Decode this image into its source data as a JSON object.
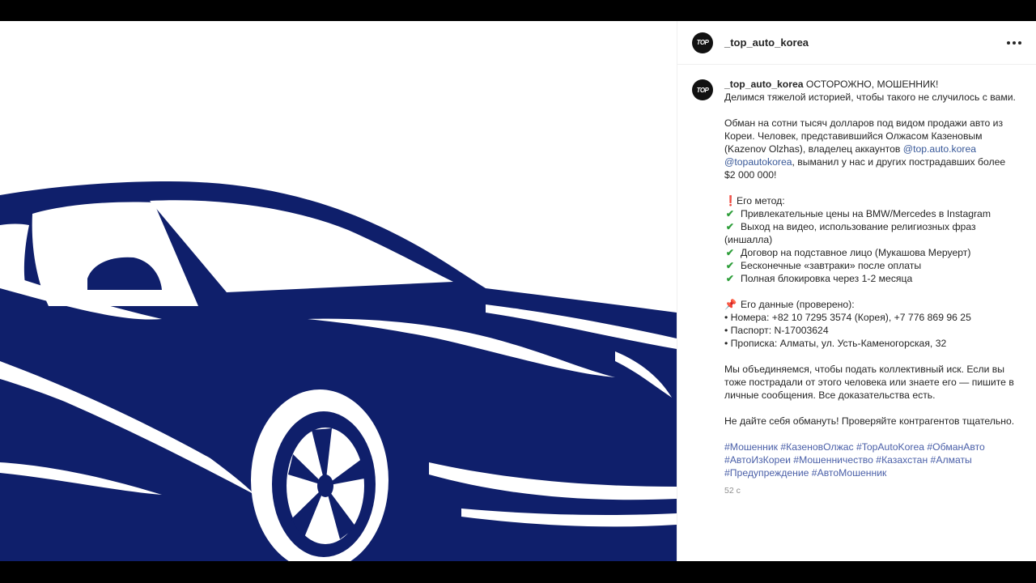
{
  "header": {
    "username": "_top_auto_korea",
    "avatar_text": "TOP",
    "more_icon": "more-horizontal-icon"
  },
  "caption": {
    "username": "_top_auto_korea",
    "title": "ОСТОРОЖНО, МОШЕННИК!",
    "intro": "Делимся тяжелой историей, чтобы такого не случилось с вами.",
    "p2_a": "Обман на сотни тысяч долларов под видом продажи авто из Кореи. Человек, представившийся Олжасом Казеновым (Kazenov Olzhas), владелец аккаунтов ",
    "p2_link1": "@top.auto.korea",
    "p2_link2": "@topautokorea",
    "p2_b": ", выманил у нас и других пострадавших более $2 000 000!",
    "method_title": "Его метод:",
    "method_items": [
      "Привлекательные цены на BMW/Mercedes в Instagram",
      "Выход на видео, использование религиозных фраз (иншалла)",
      "Договор на подставное лицо (Мукашова Меруерт)",
      "Бесконечные «завтраки» после оплаты",
      "Полная блокировка через 1-2 месяца"
    ],
    "data_title": "Его данные (проверено):",
    "data_items": [
      "• Номера: +82 10 7295 3574 (Корея), +7 776 869 96 25",
      "• Паспорт: N-17003624",
      "• Прописка: Алматы, ул. Усть-Каменогорская, 32"
    ],
    "p4": "Мы объединяемся, чтобы подать коллективный иск. Если вы тоже пострадали от этого человека или знаете его — пишите в личные сообщения. Все доказательства есть.",
    "p5": "Не дайте себя обмануть! Проверяйте контрагентов тщательно.",
    "hashtags": "#Мошенник #КазеновОлжас #TopAutoKorea #ОбманАвто #АвтоИзКореи #Мошенничество #Казахстан #Алматы #Предупреждение #АвтоМошенник",
    "time": "52 с"
  },
  "colors": {
    "car": "#0f1f6b",
    "link": "#385898"
  },
  "icons": {
    "method": "exclamation-mark-icon",
    "check": "check-mark-icon",
    "data": "pushpin-icon"
  }
}
